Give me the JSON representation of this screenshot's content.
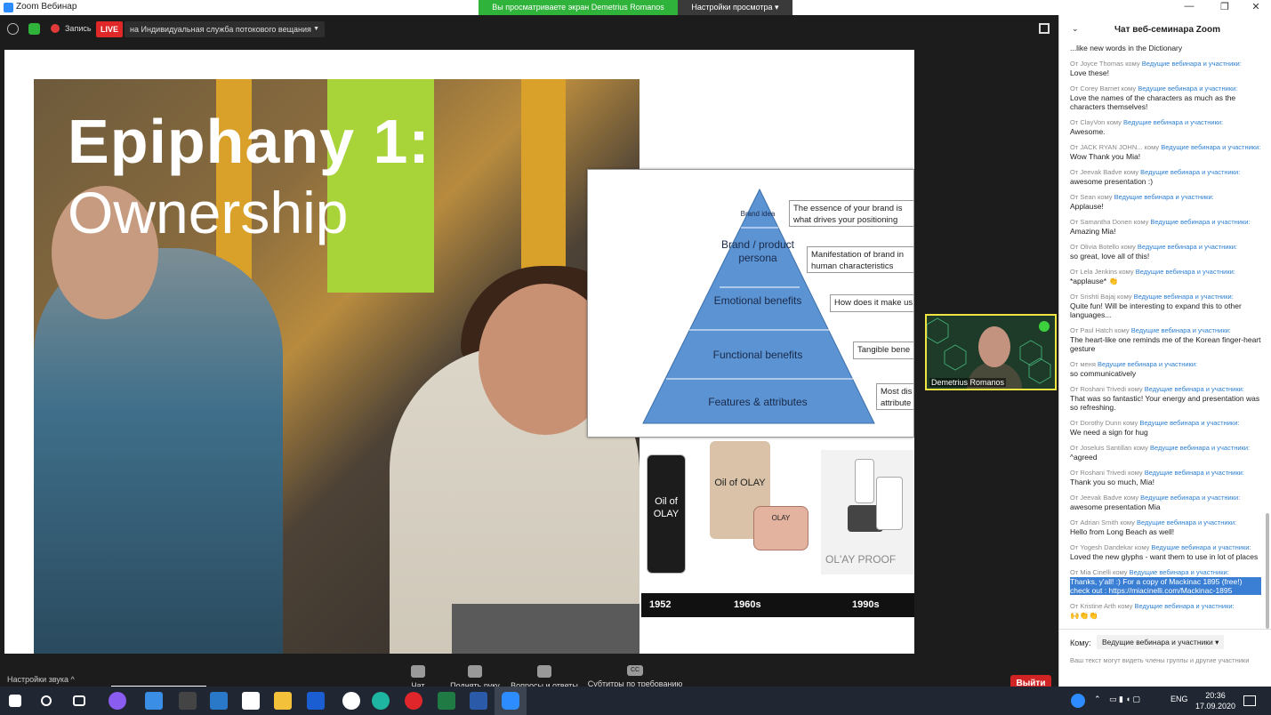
{
  "window": {
    "title": "Zoom Вебинар",
    "share_banner": "Вы просматриваете экран Demetrius Romanos",
    "view_settings": "Настройки просмотра ▾",
    "minimize": "—",
    "restore": "❐",
    "close": "✕"
  },
  "topbar": {
    "record_label": "Запись",
    "live_label": "LIVE",
    "stream_target": "на Индивидуальная служба потокового вещания"
  },
  "slide": {
    "title_line1": "Epiphany 1:",
    "title_line2": "Ownership",
    "pyramid_levels": [
      "Brand idea",
      "Brand / product persona",
      "Emotional benefits",
      "Functional benefits",
      "Features & attributes"
    ],
    "pyramid_notes": [
      "The essence of your brand is what drives your positioning",
      "Manifestation of brand in human characteristics",
      "How does it make us",
      "Tangible bene",
      "Most dis attribute"
    ],
    "olay_labels": [
      "Oil of OLAY",
      "Oil of OLAY",
      "OLAY",
      "OL'AY PROOF"
    ],
    "timeline": [
      "1952",
      "1960s",
      "1990s"
    ]
  },
  "video": {
    "participant_name": "Demetrius Romanos"
  },
  "toolbar": {
    "sound_settings": "Настройки звука ^",
    "chat": "Чат",
    "raise_hand": "Поднять руку",
    "qa": "Вопросы и ответы",
    "captions": "Субтитры по требованию",
    "captions_icon": "CC",
    "exit": "Выйти"
  },
  "chat": {
    "title": "Чат веб-семинара Zoom",
    "top_text": "...like new words in the Dictionary",
    "to_label": "Ведущие вебинара и участники:",
    "messages": [
      {
        "from": "От Joyce Thomas кому ",
        "text": "Love these!"
      },
      {
        "from": "От Corey Barnet кому ",
        "text": "Love the names of the characters as much as the characters themselves!"
      },
      {
        "from": "От ClayVon кому ",
        "text": "Awesome."
      },
      {
        "from": "От JACK RYAN JOHN... кому ",
        "text": "Wow Thank you Mia!"
      },
      {
        "from": "От Jeevak Badve кому ",
        "text": "awesome presentation :)"
      },
      {
        "from": "От Sean кому ",
        "text": "Applause!"
      },
      {
        "from": "От Samantha Donen кому ",
        "text": "Amazing Mia!"
      },
      {
        "from": "От Olivia Botello кому ",
        "text": "so great, love all of this!"
      },
      {
        "from": "От Lela Jenkins кому ",
        "text": "*applause* 👏"
      },
      {
        "from": "От Srishti Bajaj кому ",
        "text": "Quite fun! Will be interesting to expand this to other languages..."
      },
      {
        "from": "От Paul Hatch кому ",
        "text": "The heart-like one reminds me of the Korean finger-heart gesture"
      },
      {
        "from": "От меня ",
        "text": "so communicatively"
      },
      {
        "from": "От Roshani Trivedi кому ",
        "text": "That was so fantastic! Your energy and presentation was so refreshing."
      },
      {
        "from": "От Dorothy Dunn кому ",
        "text": "We need a sign for hug"
      },
      {
        "from": "От Joseluis Santillan кому ",
        "text": "^agreed"
      },
      {
        "from": "От Roshani Trivedi кому ",
        "text": "Thank you so much, Mia!"
      },
      {
        "from": "От Jeevak Badve кому ",
        "text": "awesome presentation Mia"
      },
      {
        "from": "От Adrian Smith кому ",
        "text": "Hello from Long Beach as well!"
      },
      {
        "from": "От Yogesh Dandekar кому ",
        "text": "Loved the new glyphs - want them to use in lot of places"
      },
      {
        "from": "От Mia Cinelli кому ",
        "text": "Thanks, y'all! :) For a copy of Mackinac 1895 (free!) check out : https://miacinelli.com/Mackinac-1895"
      },
      {
        "from": "От Kristine Arth кому ",
        "text": "🙌👏👏"
      }
    ],
    "komu_label": "Кому:",
    "destination": "Ведущие вебинара и участники ▾",
    "hint": "Ваш текст могут видеть члены группы и другие участники"
  },
  "taskbar": {
    "lang": "ENG",
    "time": "20:36",
    "date": "17.09.2020"
  }
}
